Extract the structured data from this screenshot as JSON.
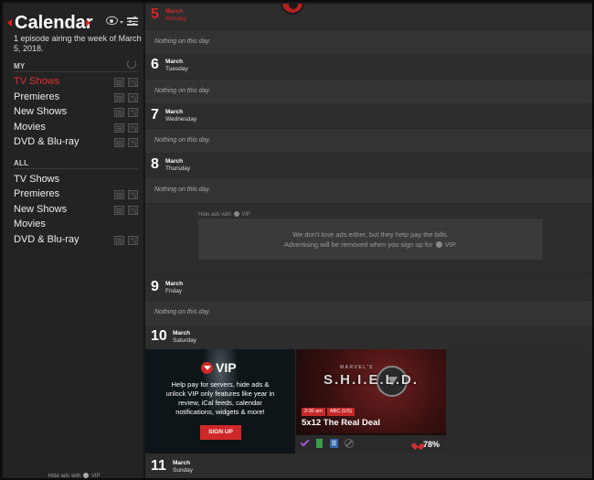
{
  "sidebar": {
    "title": "Calendar",
    "subtitle": "1 episode airing the week of March 5, 2018.",
    "section_my": "MY",
    "section_all": "ALL",
    "my_items": [
      {
        "label": "TV Shows",
        "active": true
      },
      {
        "label": "Premieres"
      },
      {
        "label": "New Shows"
      },
      {
        "label": "Movies"
      },
      {
        "label": "DVD & Blu-ray"
      }
    ],
    "all_items": [
      {
        "label": "TV Shows"
      },
      {
        "label": "Premieres"
      },
      {
        "label": "New Shows"
      },
      {
        "label": "Movies"
      },
      {
        "label": "DVD & Blu-ray"
      }
    ],
    "footer_prefix": "Hide ads with",
    "footer_vip": "VIP"
  },
  "days": [
    {
      "num": "5",
      "month": "March",
      "weekday": "Monday",
      "today": true,
      "empty_text": "Nothing on this day."
    },
    {
      "num": "6",
      "month": "March",
      "weekday": "Tuesday",
      "empty_text": "Nothing on this day."
    },
    {
      "num": "7",
      "month": "March",
      "weekday": "Wednesday",
      "empty_text": "Nothing on this day."
    },
    {
      "num": "8",
      "month": "March",
      "weekday": "Thursday",
      "empty_text": "Nothing on this day."
    },
    {
      "num": "9",
      "month": "March",
      "weekday": "Friday",
      "empty_text": "Nothing on this day."
    },
    {
      "num": "10",
      "month": "March",
      "weekday": "Saturday"
    },
    {
      "num": "11",
      "month": "March",
      "weekday": "Sunday"
    }
  ],
  "ad": {
    "hide_label": "Hide ads with",
    "hide_vip": "VIP",
    "line1": "We don't love ads either, but they help pay the bills.",
    "line2": "Advertising will be removed when you sign up for",
    "line2_vip": "VIP."
  },
  "vip_card": {
    "brand": "VIP",
    "text": "Help pay for servers, hide ads & unlock VIP only features like year in review, iCal feeds, calendar notifications, widgets & more!",
    "signup": "SIGN UP"
  },
  "show_card": {
    "logo_small": "MARVEL'S",
    "logo": "S.H.I.E.L.D.",
    "time": "2:00 am",
    "network": "ABC (US)",
    "episode": "5x12 The Real Deal",
    "rating": "78%"
  },
  "colors": {
    "accent": "#d02828",
    "background": "#2b2b2b",
    "sidebar": "#232323"
  }
}
